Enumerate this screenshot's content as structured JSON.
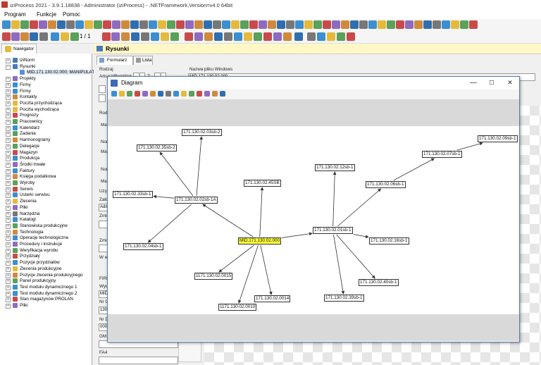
{
  "window": {
    "title": "iziProcess 2021 - 3.9.1.18838 - Administrator (iziProcess) - .NETFramework,Version=v4.0 64bit"
  },
  "menu": [
    "Program",
    "Funkcje",
    "Pomoc"
  ],
  "paging": {
    "text": "1 / 1"
  },
  "navigator": {
    "tab_label": "Nawigator",
    "items": [
      {
        "label": "iziNorm",
        "level": 0,
        "exp": "+",
        "color": "#4a7ab5"
      },
      {
        "label": "Rysunki",
        "level": 0,
        "exp": "−",
        "color": "#4a7ab5"
      },
      {
        "label": "MID.171.130.02.000; MANIPULAT",
        "level": 1,
        "exp": "",
        "color": "#5b8fd4",
        "selected": true
      },
      {
        "label": "Projekty",
        "level": 0,
        "exp": "+",
        "color": "#8e6bbf"
      },
      {
        "label": "Firmy",
        "level": 0,
        "exp": "+",
        "color": "#3b8ed0"
      },
      {
        "label": "Firmy",
        "level": 0,
        "exp": "+",
        "color": "#3b8ed0"
      },
      {
        "label": "Kontakty",
        "level": 0,
        "exp": "+",
        "color": "#d08a3b"
      },
      {
        "label": "Poczta przychodząca",
        "level": 0,
        "exp": "+",
        "color": "#e5b93b"
      },
      {
        "label": "Poczta wychodząca",
        "level": 0,
        "exp": "+",
        "color": "#e5b93b"
      },
      {
        "label": "Prognozy",
        "level": 0,
        "exp": "+",
        "color": "#c94a4a"
      },
      {
        "label": "Pracownicy",
        "level": 0,
        "exp": "+",
        "color": "#5aa15a"
      },
      {
        "label": "Kalendarz",
        "level": 0,
        "exp": "+",
        "color": "#3b8ed0"
      },
      {
        "label": "Zadania",
        "level": 0,
        "exp": "+",
        "color": "#5aa15a"
      },
      {
        "label": "Harmonogramy",
        "level": 0,
        "exp": "+",
        "color": "#d08a3b"
      },
      {
        "label": "Delegacje",
        "level": 0,
        "exp": "+",
        "color": "#5aa15a"
      },
      {
        "label": "Magazyn",
        "level": 0,
        "exp": "+",
        "color": "#c94a4a"
      },
      {
        "label": "Produkcja",
        "level": 0,
        "exp": "+",
        "color": "#3b8ed0"
      },
      {
        "label": "Środki trwałe",
        "level": 0,
        "exp": "+",
        "color": "#8e6bbf"
      },
      {
        "label": "Faktury",
        "level": 0,
        "exp": "+",
        "color": "#3b8ed0"
      },
      {
        "label": "Księga podatkowa",
        "level": 0,
        "exp": "+",
        "color": "#d08a3b"
      },
      {
        "label": "Wyroby",
        "level": 0,
        "exp": "+",
        "color": "#5aa15a"
      },
      {
        "label": "Serwis",
        "level": 0,
        "exp": "+",
        "color": "#c94a4a"
      },
      {
        "label": "Usterki serwisu",
        "level": 0,
        "exp": "+",
        "color": "#3b8ed0"
      },
      {
        "label": "Zlecenia",
        "level": 0,
        "exp": "+",
        "color": "#e5b93b"
      },
      {
        "label": "Pliki",
        "level": 0,
        "exp": "+",
        "color": "#8e6bbf"
      },
      {
        "label": "Narzędzia",
        "level": 0,
        "exp": "+",
        "color": "#777777"
      },
      {
        "label": "Katalogi",
        "level": 0,
        "exp": "+",
        "color": "#3b8ed0"
      },
      {
        "label": "Stanowiska produkcyjne",
        "level": 0,
        "exp": "+",
        "color": "#5aa15a"
      },
      {
        "label": "Technologia",
        "level": 0,
        "exp": "+",
        "color": "#d08a3b"
      },
      {
        "label": "Operacje technologiczne",
        "level": 0,
        "exp": "+",
        "color": "#3b8ed0"
      },
      {
        "label": "Procedury i instrukcje",
        "level": 0,
        "exp": "+",
        "color": "#8e6bbf"
      },
      {
        "label": "Weryfikacja wyrobu",
        "level": 0,
        "exp": "+",
        "color": "#5aa15a"
      },
      {
        "label": "Przydziały",
        "level": 0,
        "exp": "+",
        "color": "#c94a4a"
      },
      {
        "label": "Pozycje przydziałów",
        "level": 0,
        "exp": "+",
        "color": "#3b8ed0"
      },
      {
        "label": "Zlecenia produkcyjne",
        "level": 0,
        "exp": "+",
        "color": "#e5b93b"
      },
      {
        "label": "Pozycje zlecenia produkcyjnego",
        "level": 0,
        "exp": "+",
        "color": "#d08a3b"
      },
      {
        "label": "Panel produkcyjny",
        "level": 0,
        "exp": "+",
        "color": "#5aa15a"
      },
      {
        "label": "Test modułu dynamicznego 1",
        "level": 0,
        "exp": "+",
        "color": "#3b8ed0"
      },
      {
        "label": "Test modułu dynamicznego 2",
        "level": 0,
        "exp": "+",
        "color": "#3b8ed0"
      },
      {
        "label": "Stan magazynów PROLAN",
        "level": 0,
        "exp": "+",
        "color": "#c94a4a"
      },
      {
        "label": "Pliki",
        "level": 0,
        "exp": "+",
        "color": "#8e6bbf"
      }
    ]
  },
  "main": {
    "header": "Rysunki",
    "tabs": [
      "Formularz",
      "Lista"
    ],
    "labels": {
      "rodzaj": "Rodzaj",
      "arkusz": "Arkusz/Rozdział",
      "arkusz_val": "1",
      "z": "Z",
      "z_val": "1",
      "nazwa_pliku": "Nazwa pliku Windows",
      "nazwa_pliku_val": "MID.171.130.02.000",
      "rodz": "Rodz",
      "mate1": "Mate",
      "nom1": "Nom",
      "mate2": "Mate",
      "nom2": "Nom",
      "masa": "Masa",
      "uzyt": "Użytk",
      "zalo": "Założ",
      "zalo_val": "Admi",
      "zmien1": "Zmien",
      "zmien2": "Zmien",
      "wedyc": "W edy",
      "firma": "FIRM",
      "wyd": "Wyd",
      "wyd_val": "MID.",
      "nrgr": "Nr Gr",
      "nrgr_val": "130.0",
      "nrde": "Nr De",
      "nrde_val": "000",
      "gm": "GM",
      "fa4": "FA4"
    }
  },
  "diagram": {
    "title": "Diagram",
    "min": "—",
    "max": "☐",
    "close": "✕",
    "nodes": [
      {
        "id": "c",
        "label": "MID.171.130.02.000",
        "selected": true
      },
      {
        "id": "n1",
        "label": "171.130.02.02sb-1A"
      },
      {
        "id": "n2",
        "label": "171.130.02.03sb-2"
      },
      {
        "id": "n3",
        "label": "171.130.02.35sb-2"
      },
      {
        "id": "n4",
        "label": "171.130.02.33sb-1"
      },
      {
        "id": "n5",
        "label": "171.130.02.04sb-1"
      },
      {
        "id": "n6",
        "label": "171.130.02.45SB"
      },
      {
        "id": "n7",
        "label": "1171.130.02.0015"
      },
      {
        "id": "n8",
        "label": "1171.130.02.0010"
      },
      {
        "id": "n9",
        "label": "171.130.02.0014"
      },
      {
        "id": "n10",
        "label": "171.130.02.01sb-1"
      },
      {
        "id": "n11",
        "label": "171.130.02.12sb-1"
      },
      {
        "id": "n12",
        "label": "171.130.02.06sb-1"
      },
      {
        "id": "n13",
        "label": "171.130.02.07sb-1"
      },
      {
        "id": "n14",
        "label": "171.130.02.09sb-1"
      },
      {
        "id": "n15",
        "label": "171.130.02.16sb-1"
      },
      {
        "id": "n16",
        "label": "171.130.02.40sb-1"
      },
      {
        "id": "n17",
        "label": "171.130.02.39sb-1"
      }
    ],
    "edges": [
      [
        "c",
        "n1"
      ],
      [
        "n1",
        "n2"
      ],
      [
        "n1",
        "n3"
      ],
      [
        "n1",
        "n4"
      ],
      [
        "n1",
        "n5"
      ],
      [
        "c",
        "n6"
      ],
      [
        "c",
        "n7"
      ],
      [
        "c",
        "n8"
      ],
      [
        "c",
        "n9"
      ],
      [
        "c",
        "n10"
      ],
      [
        "n10",
        "n11"
      ],
      [
        "n10",
        "n12"
      ],
      [
        "n12",
        "n13"
      ],
      [
        "n13",
        "n14"
      ],
      [
        "n10",
        "n15"
      ],
      [
        "n10",
        "n16"
      ],
      [
        "n10",
        "n17"
      ]
    ]
  }
}
